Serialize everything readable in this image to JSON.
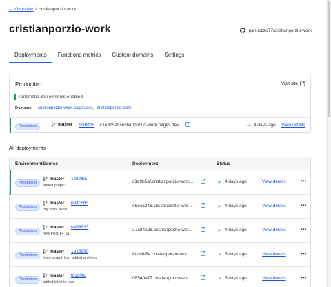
{
  "breadcrumb": {
    "back_label": "Overview",
    "separator": "/",
    "current": "cristianporzio-work"
  },
  "page": {
    "title": "cristianporzio-work"
  },
  "repo": {
    "label": "panuozzo77/cristianporzio-work"
  },
  "tabs": [
    "Deployments",
    "Functions metrics",
    "Custom domains",
    "Settings"
  ],
  "production_card": {
    "heading": "Production",
    "visit_site": "Visit site",
    "auto_deploy": "Automatic deployments enabled",
    "domains_label": "Domains:",
    "domains": [
      "cristianporzio-work.pages.dev",
      "cristianporzio.work"
    ],
    "domains_separator": ",",
    "badge": "Production",
    "branch": "master",
    "commit": "1c88fb5",
    "deployment": "c1e9b5af.cristianporzio-work.pages.dev",
    "status": "4 days ago",
    "view_details": "View details"
  },
  "all_deployments": {
    "title": "All deployments",
    "columns": [
      "Environment",
      "Source",
      "Deployment",
      "Status"
    ],
    "rows": [
      {
        "env": "Production",
        "branch": "master",
        "commit": "1c88fb5",
        "message": "added propic",
        "deployment": "c1e9b5af.cristianporzio-work...",
        "status": "4 days ago",
        "view": "View details",
        "more": "•••"
      },
      {
        "env": "Production",
        "branch": "master",
        "commit": "684c6dc",
        "message": "tiny error fixed",
        "deployment": "e6eca246.cristianporzio-wor...",
        "status": "4 days ago",
        "view": "View details",
        "more": "•••"
      },
      {
        "env": "Production",
        "branch": "master",
        "commit": "b456833",
        "message": "new Post 14_11",
        "deployment": "27a84a28.cristianporzio-wor...",
        "status": "4 days ago",
        "view": "View details",
        "more": "•••"
      },
      {
        "env": "Production",
        "branch": "master",
        "commit": "1e18990",
        "message": "fixed search bar, added archives",
        "deployment": "8dccbf7e.cristianporzio-wor...",
        "status": "5 days ago",
        "view": "View details",
        "more": "•••"
      },
      {
        "env": "Production",
        "branch": "master",
        "commit": "f6cd0fc",
        "message": "added label to post",
        "deployment": "05540e77.cristianporzio-wor...",
        "status": "5 days ago",
        "view": "View details",
        "more": "•••"
      }
    ]
  }
}
